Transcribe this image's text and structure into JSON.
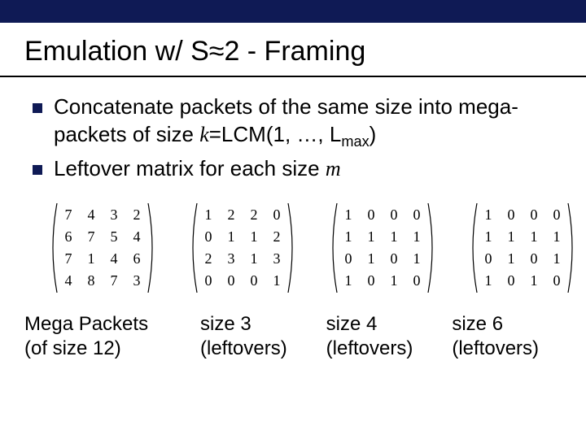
{
  "title_parts": {
    "pre": "Emulation w/ S",
    "approx": "≈",
    "post": "2 - Framing"
  },
  "bullets": [
    {
      "t1": "Concatenate packets of the same size into mega-packets of size ",
      "k": "k",
      "t2": "=LCM(1, …, L",
      "sub": "max",
      "t3": ")"
    },
    {
      "t1": "Leftover matrix for each size ",
      "m": "m"
    }
  ],
  "chart_data": {
    "type": "table",
    "matrices": [
      {
        "label": "Mega Packets (of size 12)",
        "rows": [
          [
            7,
            4,
            3,
            2
          ],
          [
            6,
            7,
            5,
            4
          ],
          [
            7,
            1,
            4,
            6
          ],
          [
            4,
            8,
            7,
            3
          ]
        ]
      },
      {
        "label": "size 3 (leftovers)",
        "rows": [
          [
            1,
            2,
            2,
            0
          ],
          [
            0,
            1,
            1,
            2
          ],
          [
            2,
            3,
            1,
            3
          ],
          [
            0,
            0,
            0,
            1
          ]
        ]
      },
      {
        "label": "size 4 (leftovers)",
        "rows": [
          [
            1,
            0,
            0,
            0
          ],
          [
            1,
            1,
            1,
            1
          ],
          [
            0,
            1,
            0,
            1
          ],
          [
            1,
            0,
            1,
            0
          ]
        ]
      },
      {
        "label": "size 6 (leftovers)",
        "rows": [
          [
            1,
            0,
            0,
            0
          ],
          [
            1,
            1,
            1,
            1
          ],
          [
            0,
            1,
            0,
            1
          ],
          [
            1,
            0,
            1,
            0
          ]
        ]
      }
    ]
  },
  "captions": {
    "c1a": "Mega Packets",
    "c1b": "(of size 12)",
    "c2a": "size 3",
    "c3a": "size 4",
    "c4a": "size 6",
    "lo": "(leftovers)"
  }
}
